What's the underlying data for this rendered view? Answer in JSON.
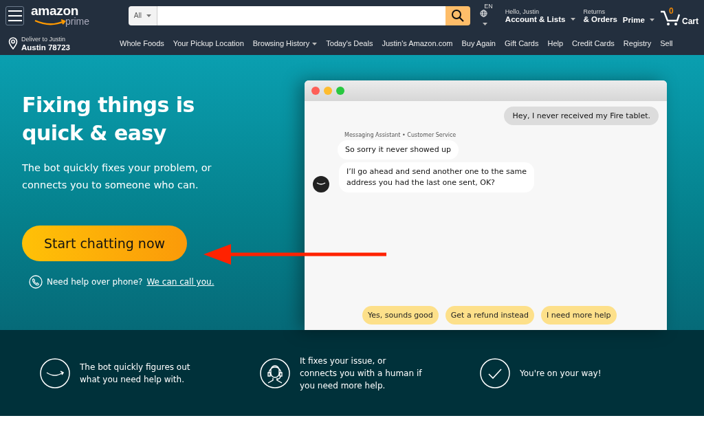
{
  "header": {
    "logo": {
      "word": "amazon",
      "sub": "prime"
    },
    "search": {
      "category": "All"
    },
    "language": "EN",
    "account": {
      "greeting": "Hello, Justin",
      "label": "Account & Lists"
    },
    "orders": {
      "top": "Returns",
      "label": "& Orders"
    },
    "prime": "Prime",
    "cart": {
      "count": "0",
      "label": "Cart"
    }
  },
  "delivery": {
    "top": "Deliver to Justin",
    "location": "Austin 78723"
  },
  "nav": [
    {
      "label": "Whole Foods",
      "dropdown": false
    },
    {
      "label": "Your Pickup Location",
      "dropdown": false
    },
    {
      "label": "Browsing History",
      "dropdown": true
    },
    {
      "label": "Today's Deals",
      "dropdown": false
    },
    {
      "label": "Justin's Amazon.com",
      "dropdown": false
    },
    {
      "label": "Buy Again",
      "dropdown": false
    },
    {
      "label": "Gift Cards",
      "dropdown": false
    },
    {
      "label": "Help",
      "dropdown": false
    },
    {
      "label": "Credit Cards",
      "dropdown": false
    },
    {
      "label": "Registry",
      "dropdown": false
    },
    {
      "label": "Sell",
      "dropdown": false
    }
  ],
  "hero": {
    "title": "Fixing things is quick & easy",
    "subtitle": "The bot quickly fixes your problem, or connects you to someone who can.",
    "cta": "Start chatting now",
    "phone_text": "Need help over phone?",
    "phone_link": "We can call you."
  },
  "chat": {
    "messages": [
      {
        "kind": "user",
        "text": "Hey, I never received my Fire tablet."
      },
      {
        "kind": "sender",
        "text": "Messaging Assistant • Customer Service"
      },
      {
        "kind": "bot",
        "text": "So sorry it never showed up"
      },
      {
        "kind": "bot_last",
        "text": "I’ll go ahead and send another one to the same address you had the last one sent, OK?"
      }
    ],
    "replies": [
      "Yes, sounds good",
      "Get a refund instead",
      "I need more help"
    ]
  },
  "steps": [
    {
      "kind": "smile",
      "text": "The bot quickly figures out what you need help with."
    },
    {
      "kind": "headset",
      "text": "It fixes your issue, or connects you with a human if you need more help."
    },
    {
      "kind": "check",
      "text": "You're on your way!"
    }
  ]
}
